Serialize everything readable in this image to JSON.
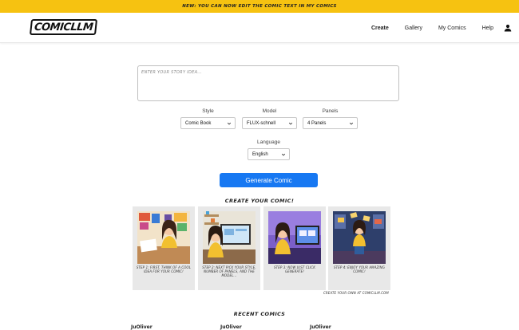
{
  "banner": {
    "text": "NEW: YOU CAN NOW EDIT THE COMIC TEXT IN MY COMICS"
  },
  "header": {
    "logo": "COMICLLM",
    "nav": [
      "Create",
      "Gallery",
      "My Comics",
      "Help"
    ],
    "active": "Create",
    "user_icon": "user-icon"
  },
  "form": {
    "story_placeholder": "ENTER YOUR STORY IDEA...",
    "style": {
      "label": "Style",
      "value": "Comic Book"
    },
    "model": {
      "label": "Model",
      "value": "FLUX-schnell"
    },
    "panels": {
      "label": "Panels",
      "value": "4 Panels"
    },
    "language": {
      "label": "Language",
      "value": "English"
    },
    "generate_label": "Generate Comic"
  },
  "tutorial": {
    "title": "CREATE YOUR COMIC!",
    "steps": [
      {
        "caption": "STEP 1: FIRST, THINK OF A COOL IDEA FOR YOUR COMIC!"
      },
      {
        "caption": "STEP 2: NEXT PICK YOUR STYLE, NUMBER OF PANELS, AND THE MODEL..."
      },
      {
        "caption": "STEP 3: NOW JUST CLICK GENERATE!"
      },
      {
        "caption": "STEP 4: ENJOY YOUR AMAZING COMIC!"
      }
    ],
    "credit": "CREATE YOUR OWN AT COMICLLM.COM"
  },
  "recent": {
    "title": "RECENT COMICS",
    "authors": [
      "JuOliver",
      "JuOliver",
      "JuOliver"
    ]
  },
  "colors": {
    "banner": "#f6c211",
    "primary_button": "#1778f2"
  }
}
